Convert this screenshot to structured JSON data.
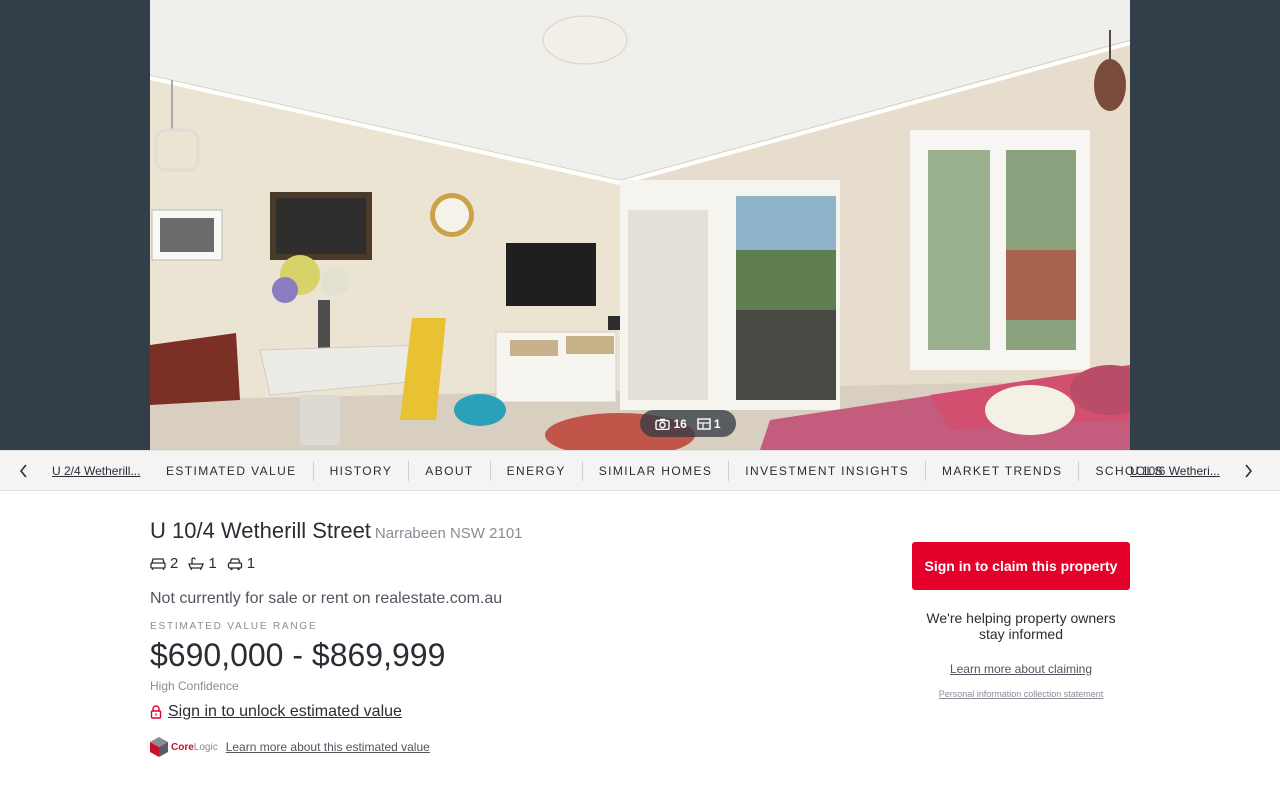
{
  "hero": {
    "photo_count": "16",
    "floorplan_count": "1"
  },
  "nav": {
    "prev_property": "U 2/4 Wetherill...",
    "next_property": "U 10/6 Wetheri...",
    "tabs": [
      "ESTIMATED VALUE",
      "HISTORY",
      "ABOUT",
      "ENERGY",
      "SIMILAR HOMES",
      "INVESTMENT INSIGHTS",
      "MARKET TRENDS",
      "SCHOOLS"
    ]
  },
  "property": {
    "street": "U 10/4 Wetherill Street",
    "suburb": "Narrabeen NSW 2101",
    "bedrooms": "2",
    "bathrooms": "1",
    "car_spaces": "1",
    "status": "Not currently for sale or rent on realestate.com.au",
    "range_label": "ESTIMATED VALUE RANGE",
    "range_value": "$690,000 - $869,999",
    "confidence": "High Confidence",
    "unlock_label": "Sign in to unlock estimated value",
    "provider_name": "Core",
    "provider_name_suffix": "Logic",
    "learn_estimate": "Learn more about this estimated value"
  },
  "claim": {
    "button_label": "Sign in to claim this property",
    "message": "We're helping property owners stay informed",
    "learn_more": "Learn more about claiming",
    "privacy": "Personal information collection statement"
  },
  "colors": {
    "hero_background": "#333f48",
    "brand_red": "#e4002b",
    "text_dark": "#2c2c35",
    "text_muted": "#8b8b96"
  }
}
